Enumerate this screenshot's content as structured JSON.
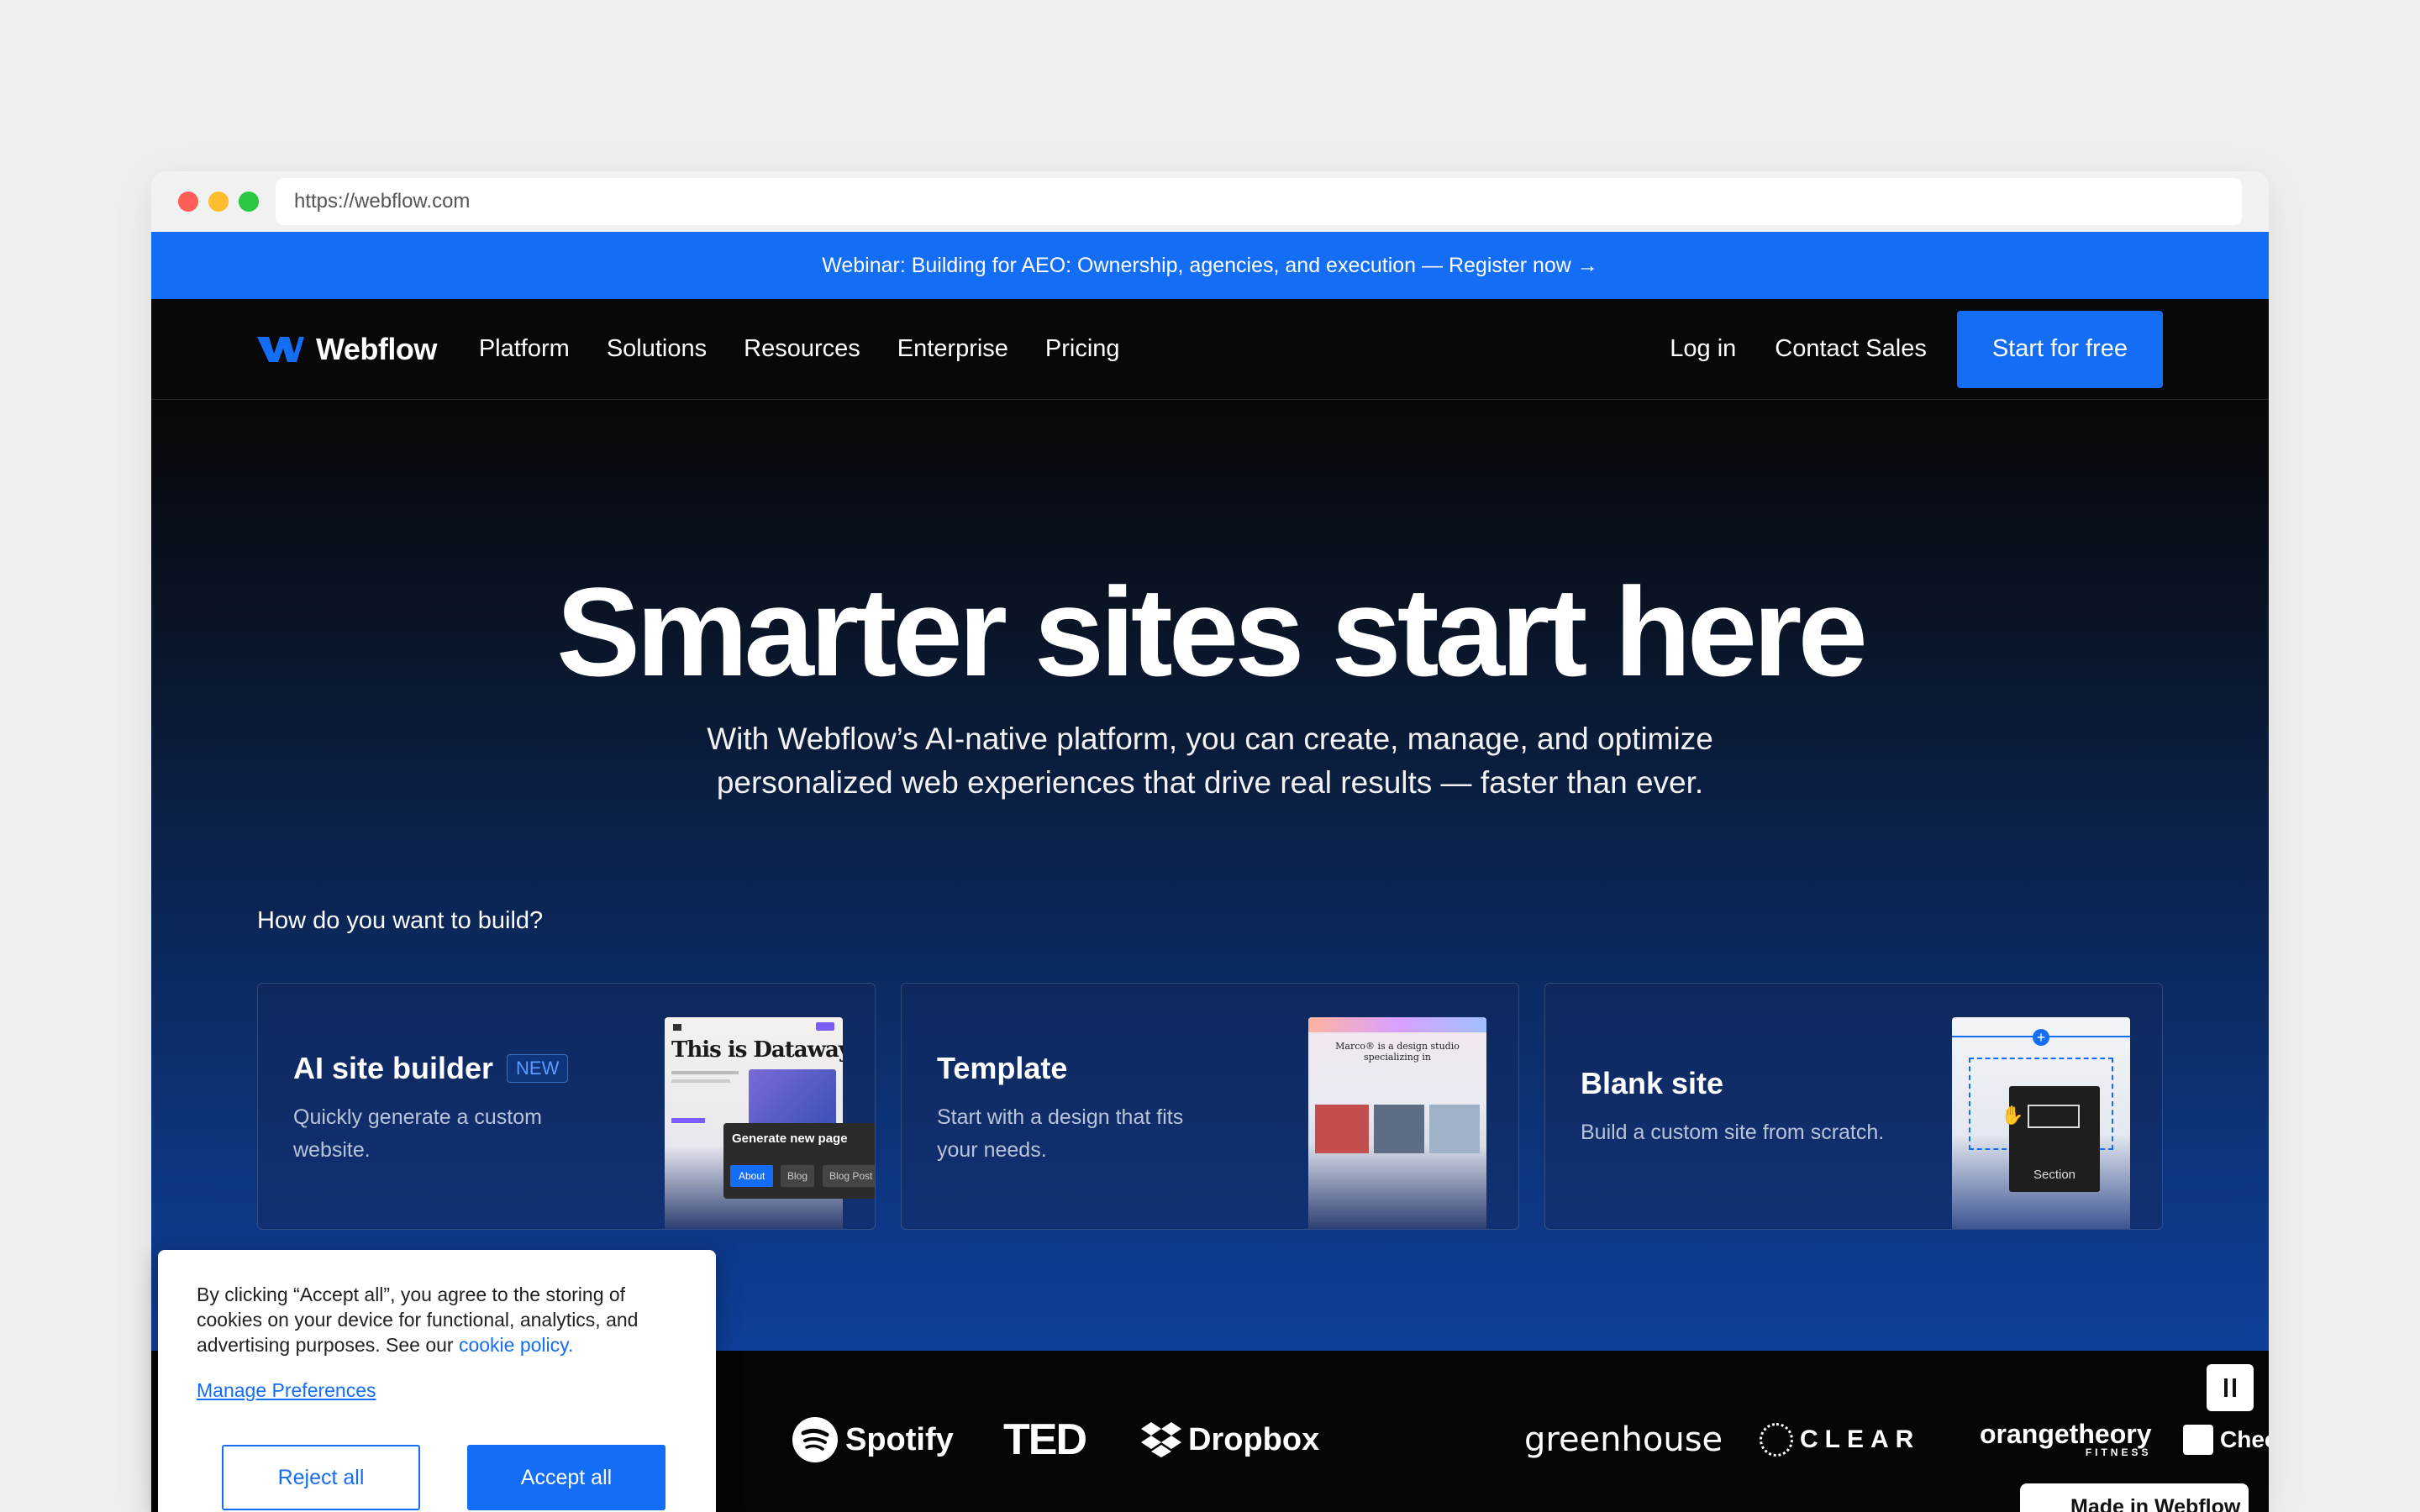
{
  "browser": {
    "url": "https://webflow.com",
    "dot_colors": [
      "#ff5f57",
      "#febc2e",
      "#28c840"
    ]
  },
  "banner": {
    "text": "Webinar: Building for AEO: Ownership, agencies, and execution — Register now →"
  },
  "nav": {
    "brand": "Webflow",
    "items": [
      "Platform",
      "Solutions",
      "Resources",
      "Enterprise",
      "Pricing"
    ],
    "login": "Log in",
    "contact": "Contact Sales",
    "cta": "Start for free"
  },
  "hero": {
    "title": "Smarter sites start here",
    "subtitle": "With Webflow’s AI-native platform, you can create, manage, and optimize personalized web experiences that drive real results — faster than ever.",
    "question": "How do you want to build?"
  },
  "cards": [
    {
      "title": "AI site builder",
      "badge": "NEW",
      "desc": "Quickly generate a custom website.",
      "thumb": {
        "headline": "This is Dataway",
        "popup_title": "Generate new page",
        "chips": [
          "About",
          "Blog",
          "Blog Post"
        ]
      }
    },
    {
      "title": "Template",
      "desc": "Start with a design that fits your needs.",
      "thumb": {
        "headline": "Marco® is a design studio specializing in"
      }
    },
    {
      "title": "Blank site",
      "desc": "Build a custom site from scratch.",
      "thumb": {
        "section_label": "Section"
      }
    }
  ],
  "logos": [
    "Spotify",
    "TED",
    "Dropbox",
    "greenhouse",
    "CLEAR",
    "orangetheory",
    "FITNESS",
    "Checkout.com"
  ],
  "cookie": {
    "text": "By clicking “Accept all”, you agree to the storing of cookies on your device for functional, analytics, and advertising purposes. See our",
    "link": "cookie policy.",
    "manage": "Manage Preferences",
    "reject": "Reject all",
    "accept": "Accept all"
  },
  "badge_made": "Made in Webflow",
  "colors": {
    "accent": "#146ef5",
    "nav_bg": "#080808"
  }
}
